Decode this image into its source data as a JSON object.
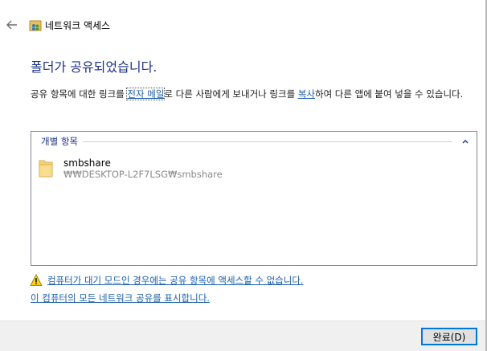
{
  "window": {
    "title": "네트워크 액세스"
  },
  "heading": "폴더가 공유되었습니다.",
  "description": {
    "part1": "공유 항목에 대한 링크를 ",
    "email_link": "전자 메일",
    "part2": "로 다른 사람에게 보내거나 링크를 ",
    "copy_link": "복사",
    "part3": "하여 다른 앱에 붙여 넣을 수 있습니다."
  },
  "list": {
    "group_label": "개별 항목",
    "items": [
      {
        "name": "smbshare",
        "path": "₩₩DESKTOP-L2F7LSG₩smbshare",
        "icon": "folder-icon"
      }
    ]
  },
  "warning": {
    "icon": "warning-icon",
    "text": "컴퓨터가 대기 모드인 경우에는 공유 항목에 액세스할 수 없습니다."
  },
  "show_all_link": "이 컴퓨터의 모든 네트워크 공유를 표시합니다.",
  "footer": {
    "finish_label": "완료(D)"
  },
  "colors": {
    "accent_link": "#1c5fad",
    "heading": "#1e3287",
    "footer_bg": "#f0f0f0",
    "button_border": "#0078d7"
  }
}
